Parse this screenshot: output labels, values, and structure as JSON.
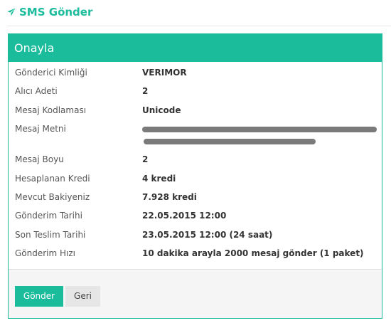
{
  "header": {
    "title": "SMS Gönder",
    "icon": "paper-plane-icon"
  },
  "panel": {
    "heading": "Onayla",
    "rows": [
      {
        "label": "Gönderici Kimliği",
        "value": "VERIMOR"
      },
      {
        "label": "Alıcı Adeti",
        "value": "2"
      },
      {
        "label": "Mesaj Kodlaması",
        "value": "Unicode"
      },
      {
        "label": "Mesaj Metni",
        "value": ""
      },
      {
        "label": "Mesaj Boyu",
        "value": "2"
      },
      {
        "label": "Hesaplanan Kredi",
        "value": "4 kredi"
      },
      {
        "label": "Mevcut Bakiyeniz",
        "value": "7.928 kredi"
      },
      {
        "label": "Gönderim Tarihi",
        "value": "22.05.2015 12:00"
      },
      {
        "label": "Son Teslim Tarihi",
        "value": "23.05.2015 12:00 (24 saat)"
      },
      {
        "label": "Gönderim Hızı",
        "value": "10 dakika arayla 2000 mesaj gönder (1 paket)"
      }
    ]
  },
  "buttons": {
    "submit": "Gönder",
    "back": "Geri"
  },
  "colors": {
    "accent": "#1abc9c",
    "redaction": "#7a7a7a"
  }
}
